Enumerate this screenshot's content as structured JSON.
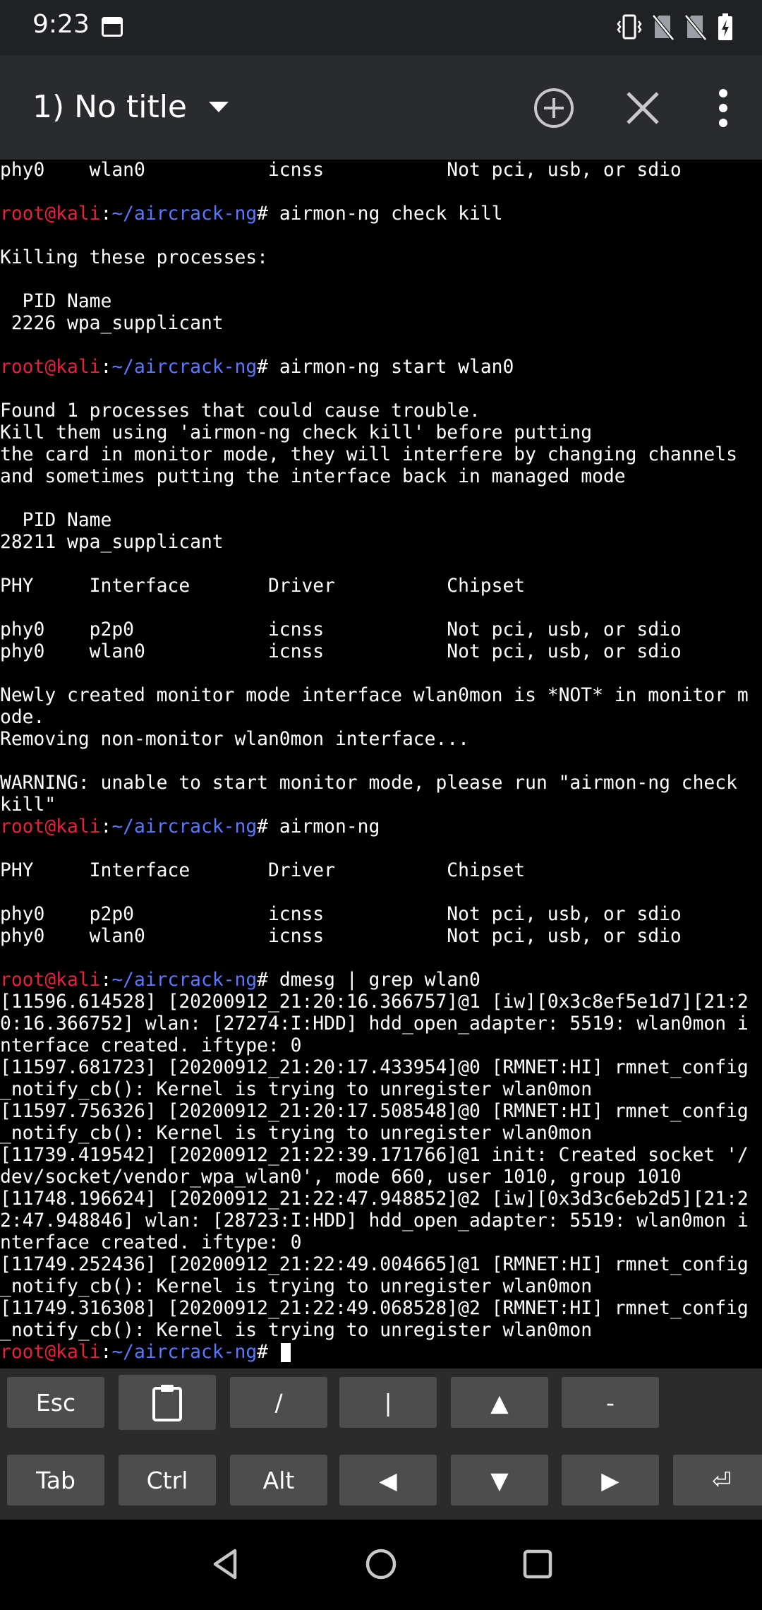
{
  "status_bar": {
    "time": "9:23",
    "icons": [
      "terminal-notification-icon",
      "vibrate-icon",
      "no-sim-icon",
      "no-sim-icon",
      "battery-charging-icon"
    ]
  },
  "toolbar": {
    "session_title": "1) No title",
    "icons": [
      "chevron-down-icon",
      "add-circle-icon",
      "close-icon",
      "more-vert-icon"
    ]
  },
  "prompt": {
    "user": "root@kali",
    "colon": ":",
    "path": "~/aircrack-ng",
    "symbol": "# "
  },
  "colors": {
    "prompt_user": "#e8203a",
    "prompt_path": "#5a78ff",
    "terminal_bg": "#000000",
    "terminal_fg": "#ffffff",
    "key_bg": "#4d4d4d"
  },
  "terminal": {
    "lines": [
      {
        "text": "phy0    wlan0           icnss           Not pci, usb, or sdio"
      },
      {
        "text": ""
      },
      {
        "prompt": true,
        "text": "airmon-ng check kill"
      },
      {
        "text": ""
      },
      {
        "text": "Killing these processes:"
      },
      {
        "text": ""
      },
      {
        "text": "  PID Name"
      },
      {
        "text": " 2226 wpa_supplicant"
      },
      {
        "text": ""
      },
      {
        "prompt": true,
        "text": "airmon-ng start wlan0"
      },
      {
        "text": ""
      },
      {
        "text": "Found 1 processes that could cause trouble."
      },
      {
        "text": "Kill them using 'airmon-ng check kill' before putting"
      },
      {
        "text": "the card in monitor mode, they will interfere by changing channels"
      },
      {
        "text": "and sometimes putting the interface back in managed mode"
      },
      {
        "text": ""
      },
      {
        "text": "  PID Name"
      },
      {
        "text": "28211 wpa_supplicant"
      },
      {
        "text": ""
      },
      {
        "text": "PHY     Interface       Driver          Chipset"
      },
      {
        "text": ""
      },
      {
        "text": "phy0    p2p0            icnss           Not pci, usb, or sdio"
      },
      {
        "text": "phy0    wlan0           icnss           Not pci, usb, or sdio"
      },
      {
        "text": ""
      },
      {
        "text": "Newly created monitor mode interface wlan0mon is *NOT* in monitor m"
      },
      {
        "text": "ode."
      },
      {
        "text": "Removing non-monitor wlan0mon interface..."
      },
      {
        "text": ""
      },
      {
        "text": "WARNING: unable to start monitor mode, please run \"airmon-ng check"
      },
      {
        "text": "kill\""
      },
      {
        "prompt": true,
        "text": "airmon-ng"
      },
      {
        "text": ""
      },
      {
        "text": "PHY     Interface       Driver          Chipset"
      },
      {
        "text": ""
      },
      {
        "text": "phy0    p2p0            icnss           Not pci, usb, or sdio"
      },
      {
        "text": "phy0    wlan0           icnss           Not pci, usb, or sdio"
      },
      {
        "text": ""
      },
      {
        "prompt": true,
        "text": "dmesg | grep wlan0"
      },
      {
        "text": "[11596.614528] [20200912_21:20:16.366757]@1 [iw][0x3c8ef5e1d7][21:2"
      },
      {
        "text": "0:16.366752] wlan: [27274:I:HDD] hdd_open_adapter: 5519: wlan0mon i"
      },
      {
        "text": "nterface created. iftype: 0"
      },
      {
        "text": "[11597.681723] [20200912_21:20:17.433954]@0 [RMNET:HI] rmnet_config"
      },
      {
        "text": "_notify_cb(): Kernel is trying to unregister wlan0mon"
      },
      {
        "text": "[11597.756326] [20200912_21:20:17.508548]@0 [RMNET:HI] rmnet_config"
      },
      {
        "text": "_notify_cb(): Kernel is trying to unregister wlan0mon"
      },
      {
        "text": "[11739.419542] [20200912_21:22:39.171766]@1 init: Created socket '/"
      },
      {
        "text": "dev/socket/vendor_wpa_wlan0', mode 660, user 1010, group 1010"
      },
      {
        "text": "[11748.196624] [20200912_21:22:47.948852]@2 [iw][0x3d3c6eb2d5][21:2"
      },
      {
        "text": "2:47.948846] wlan: [28723:I:HDD] hdd_open_adapter: 5519: wlan0mon i"
      },
      {
        "text": "nterface created. iftype: 0"
      },
      {
        "text": "[11749.252436] [20200912_21:22:49.004665]@1 [RMNET:HI] rmnet_config"
      },
      {
        "text": "_notify_cb(): Kernel is trying to unregister wlan0mon"
      },
      {
        "text": "[11749.316308] [20200912_21:22:49.068528]@2 [RMNET:HI] rmnet_config"
      },
      {
        "text": "_notify_cb(): Kernel is trying to unregister wlan0mon"
      },
      {
        "prompt": true,
        "text": "",
        "cursor": true
      }
    ]
  },
  "extra_keys": {
    "row1": [
      {
        "label": "Esc",
        "name": "esc-key"
      },
      {
        "label": "",
        "name": "paste-clipboard-key",
        "icon": "clipboard-icon"
      },
      {
        "label": "/",
        "name": "slash-key"
      },
      {
        "label": "|",
        "name": "pipe-key"
      },
      {
        "label": "▲",
        "name": "arrow-up-key"
      },
      {
        "label": "-",
        "name": "dash-key"
      }
    ],
    "row2": [
      {
        "label": "Tab",
        "name": "tab-key"
      },
      {
        "label": "Ctrl",
        "name": "ctrl-key"
      },
      {
        "label": "Alt",
        "name": "alt-key"
      },
      {
        "label": "◀",
        "name": "arrow-left-key"
      },
      {
        "label": "▼",
        "name": "arrow-down-key"
      },
      {
        "label": "▶",
        "name": "arrow-right-key"
      },
      {
        "label": "⏎",
        "name": "enter-key"
      }
    ]
  },
  "nav_bar": {
    "icons": [
      "back-icon",
      "home-icon",
      "recents-icon"
    ]
  }
}
